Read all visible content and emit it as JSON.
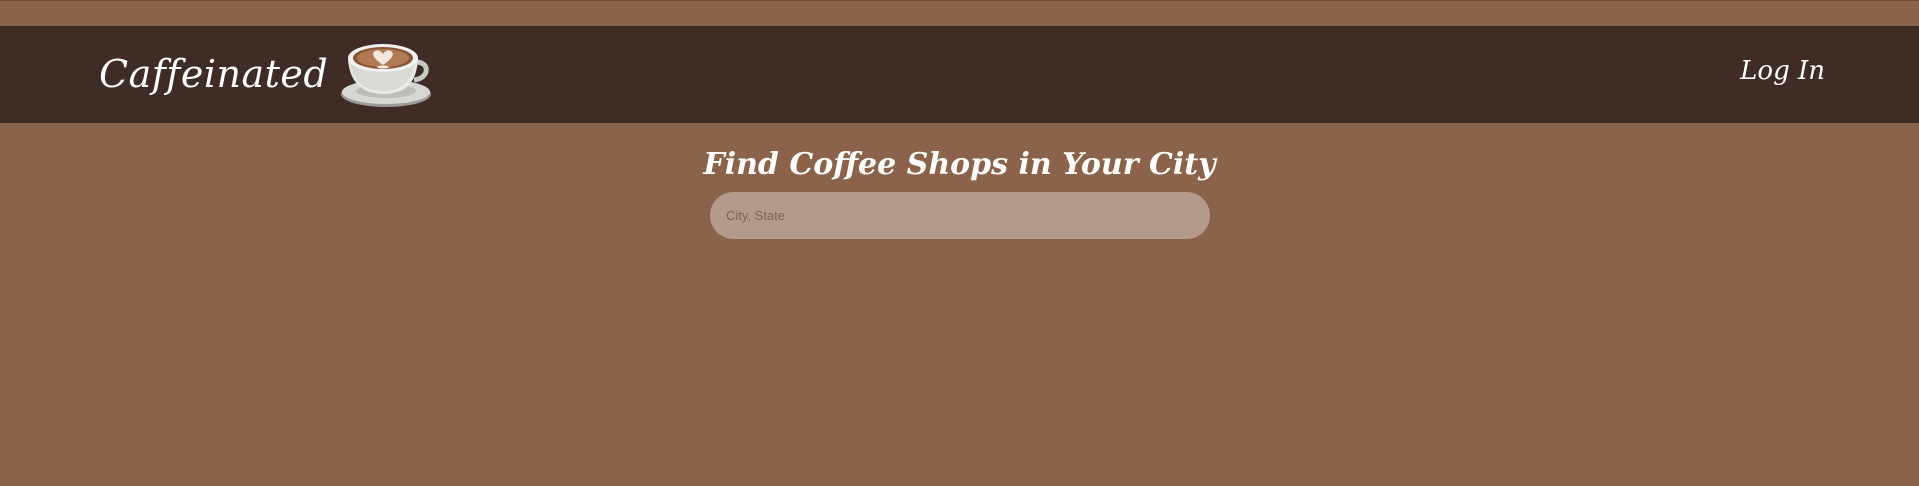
{
  "header": {
    "brand_name": "Caffeinated",
    "logo_icon": "coffee-cup-icon",
    "login_label": "Log In"
  },
  "main": {
    "title": "Find Coffee Shops in Your City",
    "search": {
      "placeholder": "City, State",
      "value": ""
    }
  },
  "colors": {
    "page_background": "#8b634a",
    "navbar_background": "#3e2c25",
    "search_background": "#b39a8d",
    "text": "#ffffff"
  }
}
